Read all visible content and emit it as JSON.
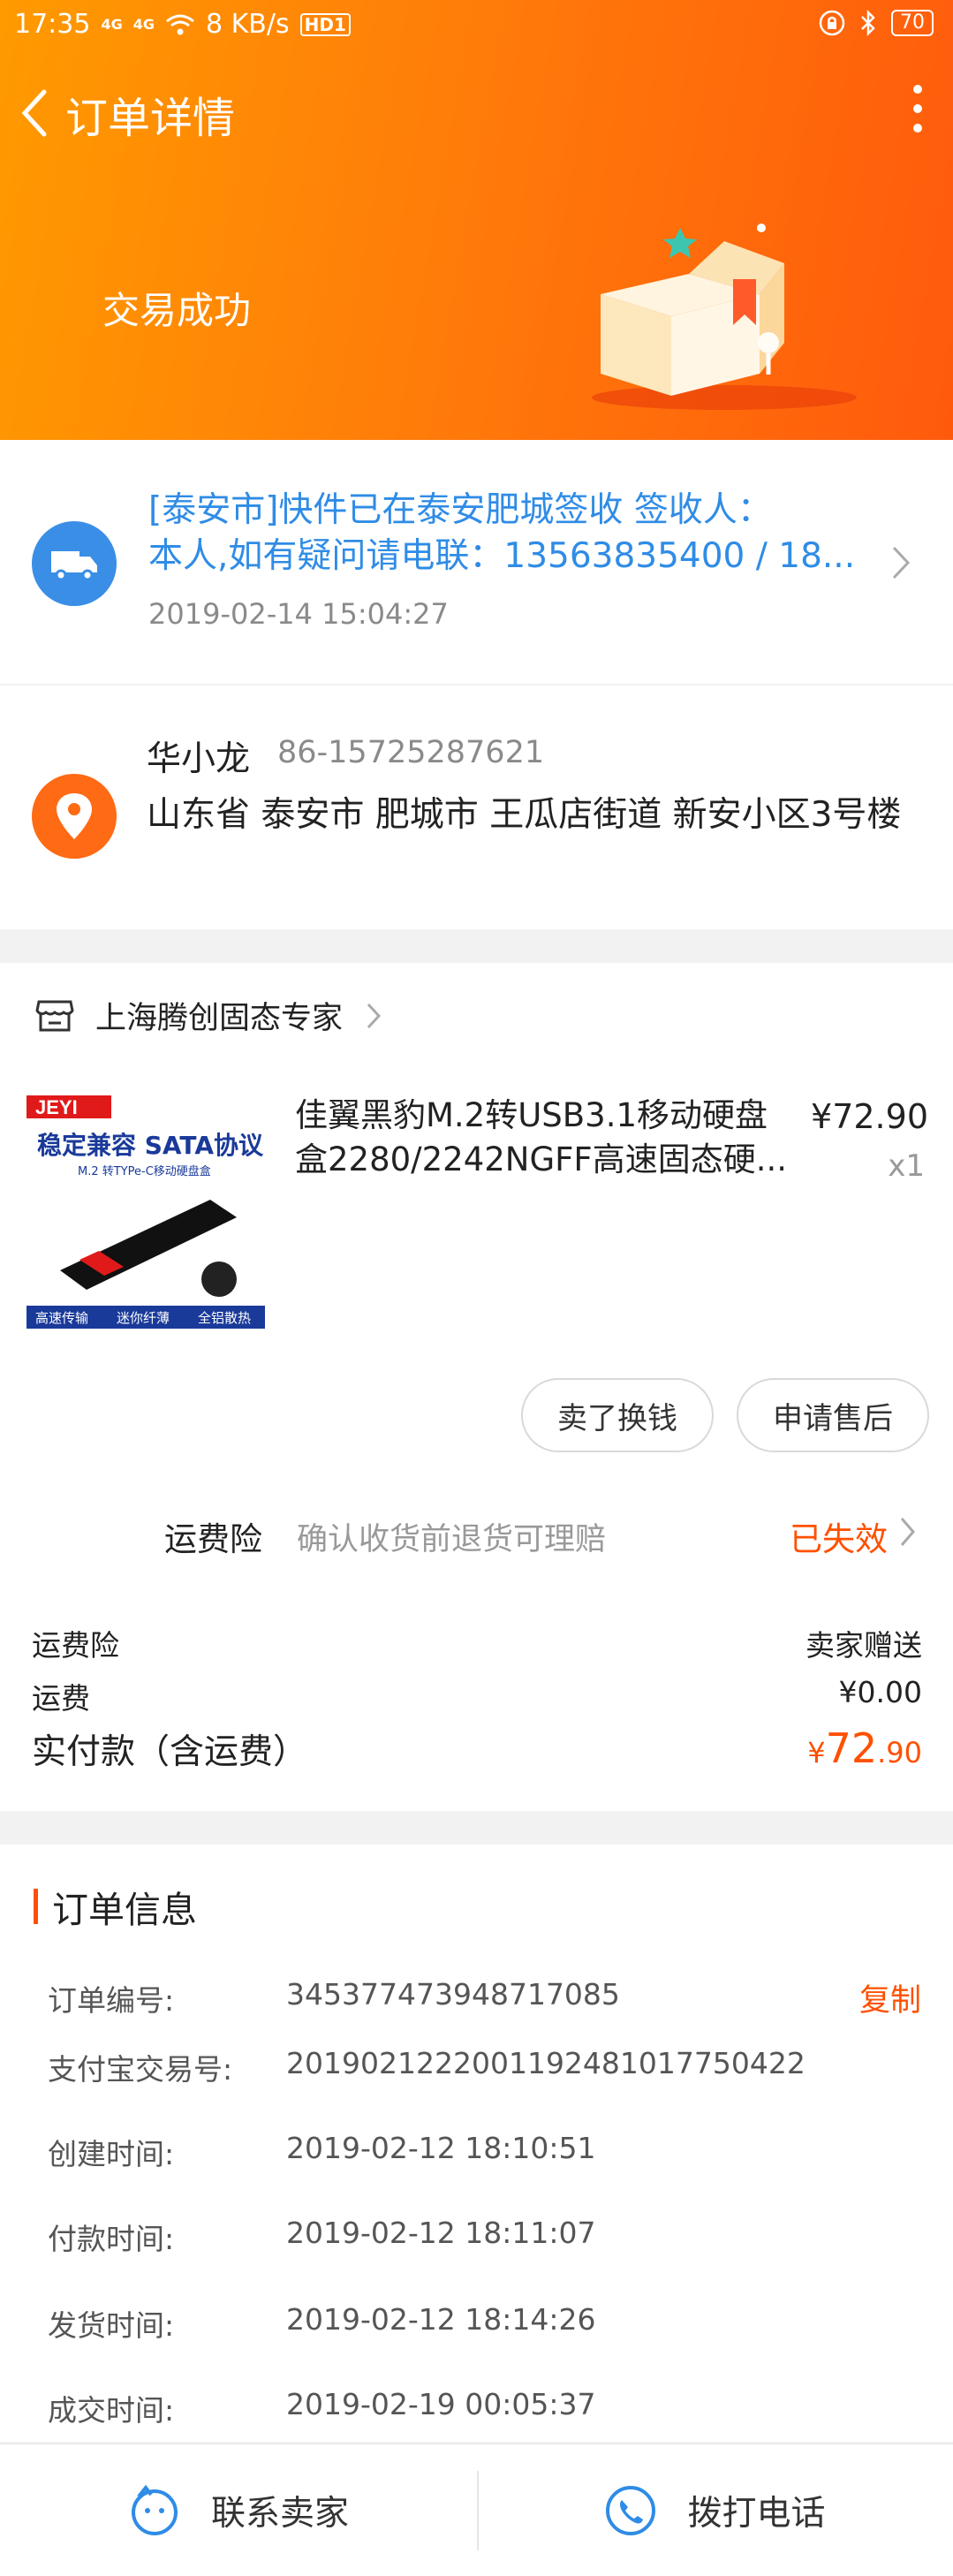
{
  "status_bar": {
    "time": "17:35",
    "net_a": "4G",
    "net_b": "4G",
    "speed": "8 KB/s",
    "hd": "HD1",
    "battery": "70"
  },
  "header": {
    "title": "订单详情",
    "state": "交易成功"
  },
  "logistics": {
    "line1": "[泰安市]快件已在泰安肥城签收 签收人：",
    "line2": "本人,如有疑问请电联：13563835400 / 18...",
    "time": "2019-02-14 15:04:27"
  },
  "address": {
    "name": "华小龙",
    "phone": "86-15725287621",
    "full": "山东省 泰安市 肥城市 王瓜店街道 新安小区3号楼"
  },
  "order": {
    "shop_name": "上海腾创固态专家",
    "product": {
      "title_line1": "佳翼黑豹M.2转USB3.1移动硬盘",
      "title_line2": "盒2280/2242NGFF高速固态硬...",
      "price": "¥72.90",
      "qty": "x1",
      "image_texts": {
        "brand": "JEYI",
        "headline": "稳定兼容 SATA协议",
        "sub": "M.2 转TYPe-C移动硬盘盒",
        "f1": "高速传输",
        "f2": "迷你纤薄",
        "f3": "全铝散热"
      }
    },
    "buttons": {
      "sell": "卖了换钱",
      "after_sale": "申请售后"
    },
    "insurance": {
      "label": "运费险",
      "desc": "确认收货前退货可理赔",
      "status": "已失效"
    },
    "fees": [
      {
        "label": "运费险",
        "value": "卖家赠送"
      },
      {
        "label": "运费",
        "value": "¥0.00"
      }
    ],
    "paid": {
      "label": "实付款（含运费）",
      "currency": "¥",
      "int": "72",
      "dec": ".90"
    }
  },
  "info": {
    "title": "订单信息",
    "copy": "复制",
    "rows": [
      {
        "label": "订单编号:",
        "value": "345377473948717085"
      },
      {
        "label": "支付宝交易号:",
        "value": "2019021222001192481017750422"
      },
      {
        "label": "创建时间:",
        "value": "2019-02-12 18:10:51"
      },
      {
        "label": "付款时间:",
        "value": "2019-02-12 18:11:07"
      },
      {
        "label": "发货时间:",
        "value": "2019-02-12 18:14:26"
      },
      {
        "label": "成交时间:",
        "value": "2019-02-19 00:05:37"
      }
    ]
  },
  "bottom_bar": {
    "contact": "联系卖家",
    "call": "拨打电话"
  },
  "colors": {
    "accent": "#ff5000",
    "link": "#2f8ce6",
    "header_start": "#ff9a00",
    "header_end": "#ff5a0c"
  },
  "icons": [
    "back-icon",
    "more-icon",
    "truck-icon",
    "location-pin-icon",
    "store-icon",
    "chevron-right-icon",
    "chat-face-icon",
    "phone-icon",
    "wifi-icon",
    "bluetooth-icon",
    "lock-icon"
  ]
}
